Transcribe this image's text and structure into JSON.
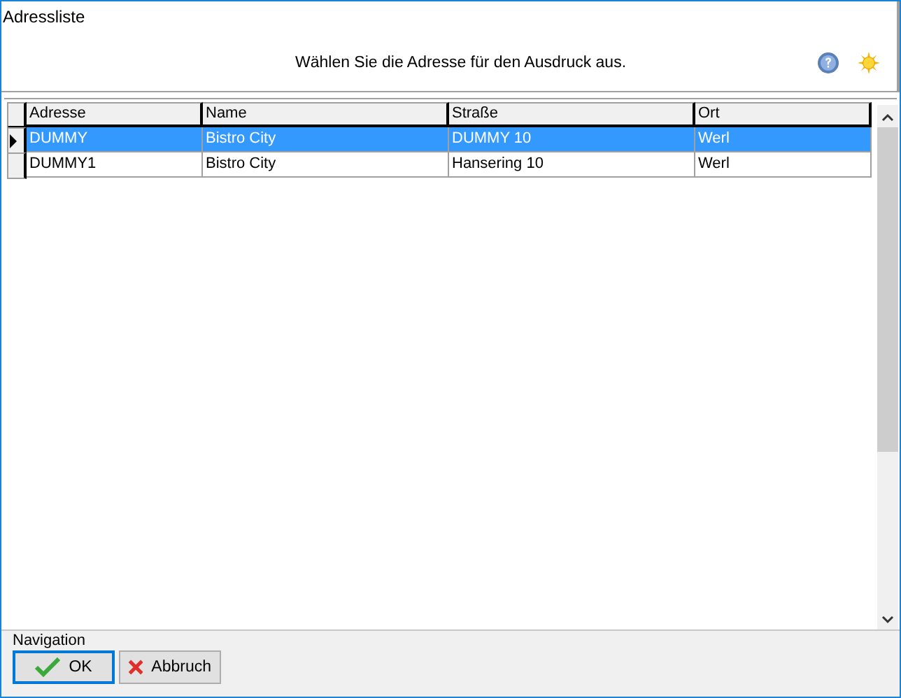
{
  "window": {
    "title": "Adressliste"
  },
  "instruction": "Wählen Sie die Adresse für den Ausdruck aus.",
  "table": {
    "columns": [
      "Adresse",
      "Name",
      "Straße",
      "Ort"
    ],
    "rows": [
      {
        "cells": [
          "DUMMY",
          "Bistro City",
          "DUMMY 10",
          "Werl"
        ],
        "selected": true
      },
      {
        "cells": [
          "DUMMY1",
          "Bistro City",
          "Hansering 10",
          "Werl"
        ],
        "selected": false
      }
    ]
  },
  "navigation": {
    "label": "Navigation",
    "buttons": [
      {
        "label": "OK",
        "kind": "ok"
      },
      {
        "label": "Abbruch",
        "kind": "cancel"
      }
    ]
  }
}
